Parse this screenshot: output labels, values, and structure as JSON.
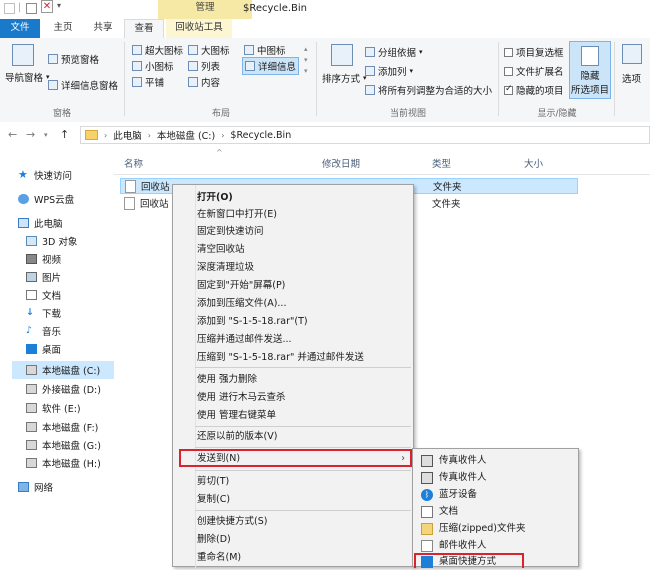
{
  "window": {
    "title": "$Recycle.Bin",
    "contextual_tab_group": "管理"
  },
  "tabs": [
    "文件",
    "主页",
    "共享",
    "查看",
    "回收站工具"
  ],
  "ribbon": {
    "pane": {
      "nav_pane": "导航窗格",
      "preview_pane": "预览窗格",
      "details_pane": "详细信息窗格",
      "group_label": "窗格"
    },
    "layout": {
      "items": [
        "超大图标",
        "大图标",
        "中图标",
        "小图标",
        "列表",
        "详细信息",
        "平铺",
        "内容"
      ],
      "group_label": "布局"
    },
    "current_view": {
      "sort_by": "排序方式",
      "group_by": "分组依据",
      "add_columns": "添加列",
      "size_all_columns": "将所有列调整为合适的大小",
      "group_label": "当前视图"
    },
    "show_hide": {
      "item_checkboxes": "项目复选框",
      "file_extensions": "文件扩展名",
      "hidden_items": "隐藏的项目",
      "hide_selected_line1": "隐藏",
      "hide_selected_line2": "所选项目",
      "group_label": "显示/隐藏",
      "checkbox_states": {
        "item_checkboxes": false,
        "file_extensions": false,
        "hidden_items": true
      }
    },
    "options": "选项"
  },
  "address": {
    "crumbs": [
      "此电脑",
      "本地磁盘 (C:)",
      "$Recycle.Bin"
    ]
  },
  "nav_pane": {
    "items": [
      {
        "label": "快速访问",
        "icon": "star-icon"
      },
      {
        "label": "WPS云盘",
        "icon": "cloud-icon"
      },
      {
        "label": "此电脑",
        "icon": "computer-icon"
      },
      {
        "label": "3D 对象",
        "icon": "cube-icon"
      },
      {
        "label": "视频",
        "icon": "video-icon"
      },
      {
        "label": "图片",
        "icon": "picture-icon"
      },
      {
        "label": "文档",
        "icon": "document-icon"
      },
      {
        "label": "下载",
        "icon": "download-icon"
      },
      {
        "label": "音乐",
        "icon": "music-icon"
      },
      {
        "label": "桌面",
        "icon": "desktop-icon"
      },
      {
        "label": "本地磁盘 (C:)",
        "icon": "drive-icon"
      },
      {
        "label": "外接磁盘 (D:)",
        "icon": "drive-icon"
      },
      {
        "label": "软件 (E:)",
        "icon": "drive-icon"
      },
      {
        "label": "本地磁盘 (F:)",
        "icon": "drive-icon"
      },
      {
        "label": "本地磁盘 (G:)",
        "icon": "drive-icon"
      },
      {
        "label": "本地磁盘 (H:)",
        "icon": "drive-icon"
      },
      {
        "label": "网络",
        "icon": "network-icon"
      }
    ]
  },
  "file_list": {
    "columns": [
      "名称",
      "修改日期",
      "类型",
      "大小"
    ],
    "rows": [
      {
        "name": "回收站",
        "type": "文件夹"
      },
      {
        "name": "回收站",
        "type": "文件夹"
      }
    ]
  },
  "context_menu": {
    "items": [
      "打开(O)",
      "在新窗口中打开(E)",
      "固定到快速访问",
      "清空回收站",
      "深度清理垃圾",
      "固定到\"开始\"屏幕(P)",
      "添加到压缩文件(A)...",
      "添加到 \"S-1-5-18.rar\"(T)",
      "压缩并通过邮件发送...",
      "压缩到 \"S-1-5-18.rar\" 并通过邮件发送",
      "使用     强力删除",
      "使用     进行木马云查杀",
      "使用     管理右键菜单",
      "还原以前的版本(V)",
      "发送到(N)",
      "剪切(T)",
      "复制(C)",
      "创建快捷方式(S)",
      "删除(D)",
      "重命名(M)"
    ]
  },
  "send_to_menu": {
    "items": [
      {
        "label": "传真收件人",
        "icon": "fax-icon"
      },
      {
        "label": "传真收件人",
        "icon": "fax-icon"
      },
      {
        "label": "蓝牙设备",
        "icon": "bluetooth-icon"
      },
      {
        "label": "文档",
        "icon": "document-icon"
      },
      {
        "label": "压缩(zipped)文件夹",
        "icon": "zip-folder-icon"
      },
      {
        "label": "邮件收件人",
        "icon": "mail-icon"
      },
      {
        "label": "桌面快捷方式",
        "icon": "desktop-icon"
      }
    ]
  },
  "colors": {
    "accent": "#1979ca",
    "selection": "#cce8ff",
    "highlight_box": "#d9232e",
    "contextual_tab": "#f6e9a6"
  }
}
